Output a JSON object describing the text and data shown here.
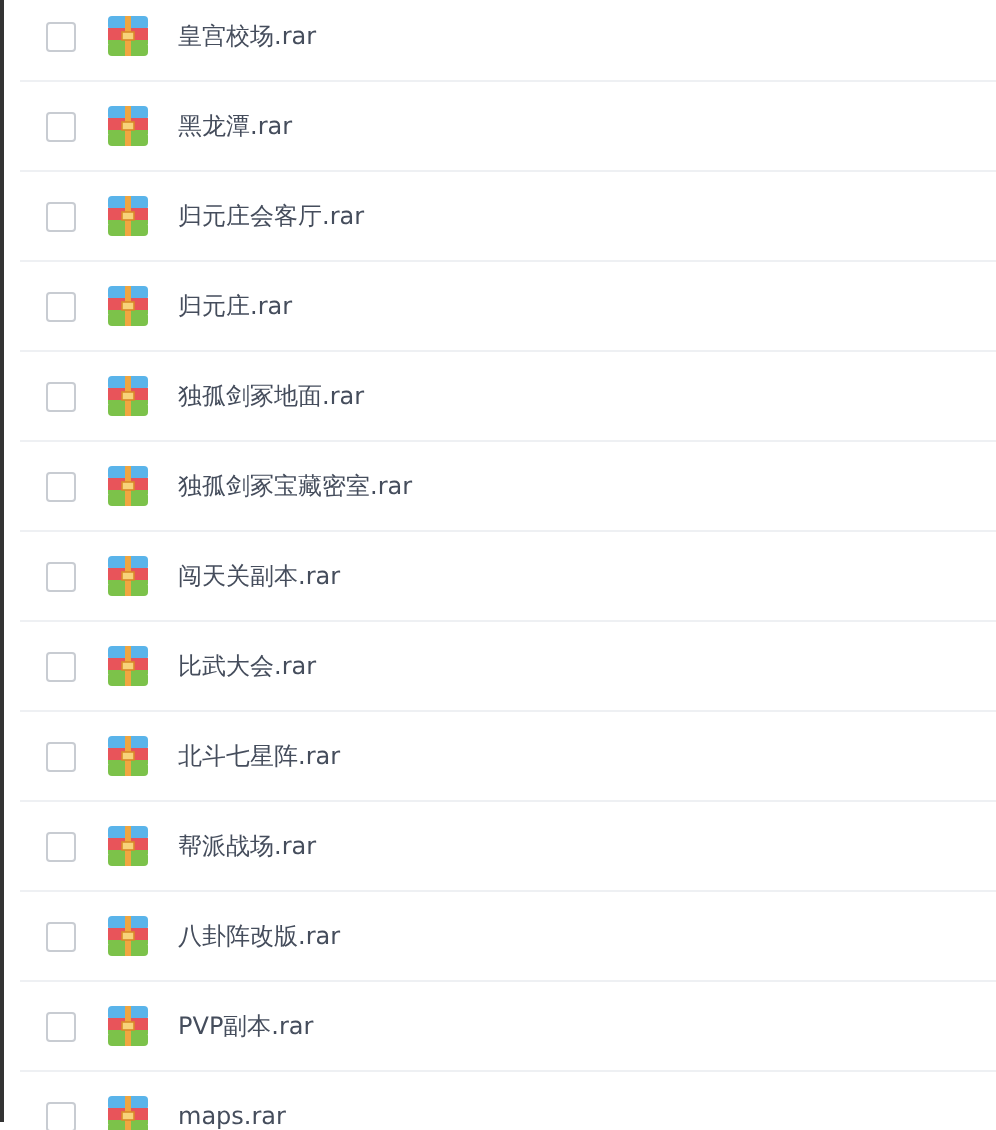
{
  "files": [
    {
      "name": "皇宫校场.rar",
      "checked": false
    },
    {
      "name": "黑龙潭.rar",
      "checked": false
    },
    {
      "name": "归元庄会客厅.rar",
      "checked": false
    },
    {
      "name": "归元庄.rar",
      "checked": false
    },
    {
      "name": "独孤剑冢地面.rar",
      "checked": false
    },
    {
      "name": "独孤剑冢宝藏密室.rar",
      "checked": false
    },
    {
      "name": "闯天关副本.rar",
      "checked": false
    },
    {
      "name": "比武大会.rar",
      "checked": false
    },
    {
      "name": "北斗七星阵.rar",
      "checked": false
    },
    {
      "name": "帮派战场.rar",
      "checked": false
    },
    {
      "name": "八卦阵改版.rar",
      "checked": false
    },
    {
      "name": "PVP副本.rar",
      "checked": false
    },
    {
      "name": "maps.rar",
      "checked": false
    }
  ]
}
